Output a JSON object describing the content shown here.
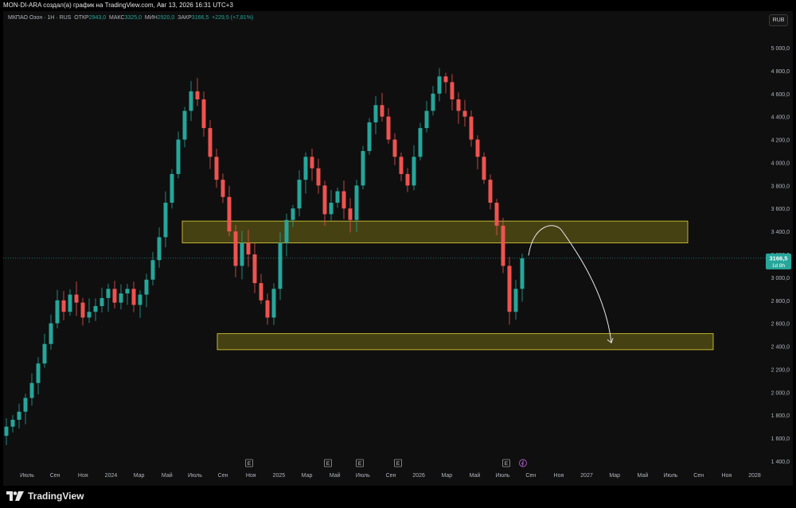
{
  "header": {
    "attribution": "MON-DI-ARA создал(а) график на TradingView.com, Авг 13, 2026 16:31 UTC+3"
  },
  "legend": {
    "symbol": "МКПАО Озон · 1Н · RUS",
    "open_label": "ОТКР",
    "open_value": "2943,0",
    "high_label": "МАКС",
    "high_value": "3325,0",
    "low_label": "МИН",
    "low_value": "2920,0",
    "close_label": "ЗАКР",
    "close_value": "3166,5",
    "change": "+229,5 (+7,81%)"
  },
  "currency_button": "RUB",
  "price_tag": {
    "price": "3166,5",
    "countdown": "1d 8h"
  },
  "footer": {
    "brand": "TradingView"
  },
  "colors": {
    "up": "#26a69a",
    "down": "#ef5350",
    "zone_fill": "#4f4a14",
    "zone_stroke": "#e3d43a",
    "background": "#0f0f0f"
  },
  "chart_data": {
    "type": "candlestick",
    "y_axis": {
      "min": 1300,
      "max": 5200,
      "ticks": [
        1400,
        1600,
        1800,
        2000,
        2200,
        2400,
        2600,
        2800,
        3000,
        3200,
        3400,
        3600,
        3800,
        4000,
        4200,
        4400,
        4600,
        4800,
        5000
      ],
      "tick_labels": [
        "1 400,0",
        "1 600,0",
        "1 800,0",
        "2 000,0",
        "2 200,0",
        "2 400,0",
        "2 600,0",
        "2 800,0",
        "3 000,0",
        "3 200,0",
        "3 400,0",
        "3 600,0",
        "3 800,0",
        "4 000,0",
        "4 200,0",
        "4 400,0",
        "4 600,0",
        "4 800,0",
        "5 000,0"
      ]
    },
    "x_axis": {
      "labels": [
        "Июль",
        "Сен",
        "Ноя",
        "2024",
        "Мар",
        "Май",
        "Июль",
        "Сен",
        "Ноя",
        "2025",
        "Мар",
        "Май",
        "Июль",
        "Сен",
        "2026",
        "Мар",
        "Май",
        "Июль",
        "Сен",
        "Ноя",
        "2027",
        "Мар",
        "Май",
        "Июль",
        "Сен",
        "Ноя",
        "2028"
      ]
    },
    "last_price": 3166.5,
    "zones": [
      {
        "low": 3300,
        "high": 3490
      },
      {
        "low": 2370,
        "high": 2510
      }
    ],
    "projection": {
      "from": 3190,
      "peak": 3420,
      "to": 2430
    },
    "earnings_markers": [
      "E",
      "E",
      "E",
      "E",
      "E"
    ],
    "closes": [
      1700,
      1760,
      1830,
      1950,
      2080,
      2250,
      2420,
      2600,
      2800,
      2700,
      2850,
      2780,
      2650,
      2700,
      2750,
      2820,
      2900,
      2780,
      2860,
      2900,
      2760,
      2850,
      2980,
      3150,
      3350,
      3650,
      3900,
      4200,
      4450,
      4620,
      4550,
      4300,
      4050,
      3850,
      3700,
      3400,
      3100,
      3300,
      3200,
      2950,
      2800,
      2650,
      2900,
      3300,
      3500,
      3600,
      3850,
      4050,
      3950,
      3800,
      3550,
      3650,
      3750,
      3600,
      3500,
      3800,
      4100,
      4350,
      4500,
      4400,
      4200,
      4050,
      3900,
      3800,
      4050,
      4300,
      4450,
      4600,
      4750,
      4700,
      4550,
      4450,
      4400,
      4200,
      4050,
      3850,
      3650,
      3450,
      3100,
      2700,
      2900,
      3166.5
    ]
  }
}
